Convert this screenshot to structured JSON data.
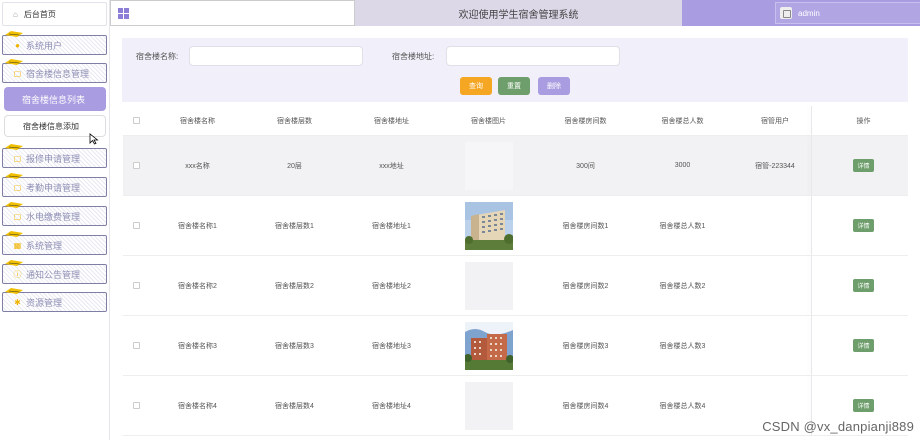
{
  "sidebar": {
    "home": "后台首页",
    "items": [
      {
        "label": "系统用户"
      },
      {
        "label": "宿舍楼信息管理"
      },
      {
        "label": "报修申请管理"
      },
      {
        "label": "考勤申请管理"
      },
      {
        "label": "水电缴费管理"
      },
      {
        "label": "系统管理"
      },
      {
        "label": "通知公告管理"
      },
      {
        "label": "资源管理"
      }
    ],
    "active": "宿舍楼信息列表",
    "sub": "宿舍楼信息添加"
  },
  "header": {
    "title": "欢迎使用学生宿舍管理系统",
    "user": "admin"
  },
  "search": {
    "name_label": "宿舍楼名称:",
    "address_label": "宿舍楼地址:",
    "name_value": "",
    "address_value": "",
    "query": "查询",
    "reset": "重置",
    "delete": "删除"
  },
  "colors": {
    "accent": "#a99ce0",
    "query": "#f5a623",
    "reset": "#6e9e6b",
    "delete": "#a99ce0"
  },
  "table": {
    "columns": [
      "宿舍楼名称",
      "宿舍楼层数",
      "宿舍楼地址",
      "宿舍楼图片",
      "宿舍楼房间数",
      "宿舍楼总人数",
      "宿管用户",
      "操作"
    ],
    "rows": [
      {
        "name": "xxx名称",
        "floors": "20层",
        "address": "xxx地址",
        "image": "empty-alt",
        "rooms": "300间",
        "people": "3000",
        "manager": "宿管-223344",
        "action": "详情"
      },
      {
        "name": "宿舍楼名称1",
        "floors": "宿舍楼层数1",
        "address": "宿舍楼地址1",
        "image": "building-a",
        "rooms": "宿舍楼房间数1",
        "people": "宿舍楼总人数1",
        "manager": "",
        "action": "详情"
      },
      {
        "name": "宿舍楼名称2",
        "floors": "宿舍楼层数2",
        "address": "宿舍楼地址2",
        "image": "empty",
        "rooms": "宿舍楼房间数2",
        "people": "宿舍楼总人数2",
        "manager": "",
        "action": "详情"
      },
      {
        "name": "宿舍楼名称3",
        "floors": "宿舍楼层数3",
        "address": "宿舍楼地址3",
        "image": "building-b",
        "rooms": "宿舍楼房间数3",
        "people": "宿舍楼总人数3",
        "manager": "",
        "action": "详情"
      },
      {
        "name": "宿舍楼名称4",
        "floors": "宿舍楼层数4",
        "address": "宿舍楼地址4",
        "image": "empty",
        "rooms": "宿舍楼房间数4",
        "people": "宿舍楼总人数4",
        "manager": "",
        "action": "详情"
      }
    ]
  },
  "watermark": "CSDN @vx_danpianji889"
}
